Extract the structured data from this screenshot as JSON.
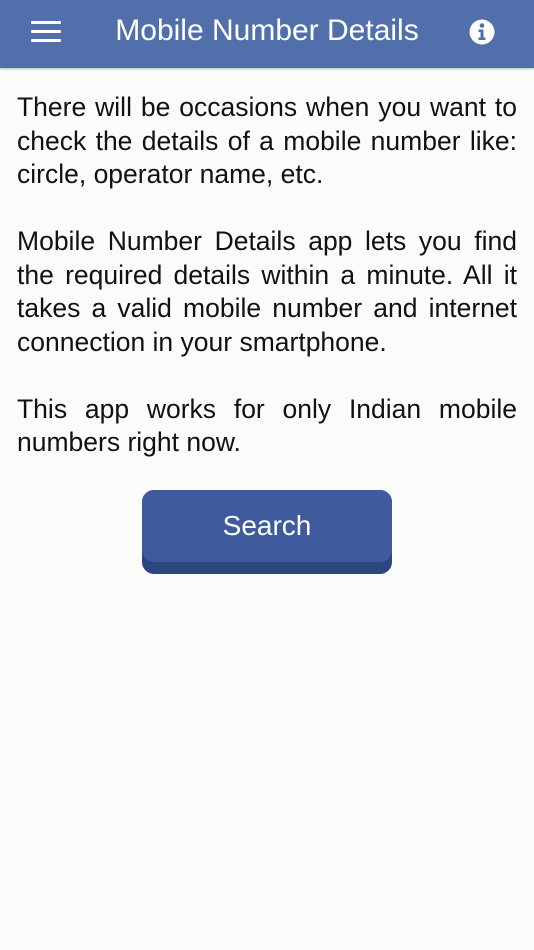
{
  "header": {
    "title": "Mobile Number Details",
    "menu_icon": "hamburger-menu-icon",
    "info_icon": "info-icon",
    "background_color": "#5170ab"
  },
  "main": {
    "paragraphs": [
      "There will be occasions when you want to check the details of a mobile number like: circle, operator name, etc.",
      "Mobile Number Details app lets you find the required details within a minute. All it takes a valid mobile number and internet connection in your smartphone.",
      "This app works for only Indian mobile numbers right now."
    ],
    "search_button_label": "Search",
    "button_color": "#3f5b9d"
  }
}
